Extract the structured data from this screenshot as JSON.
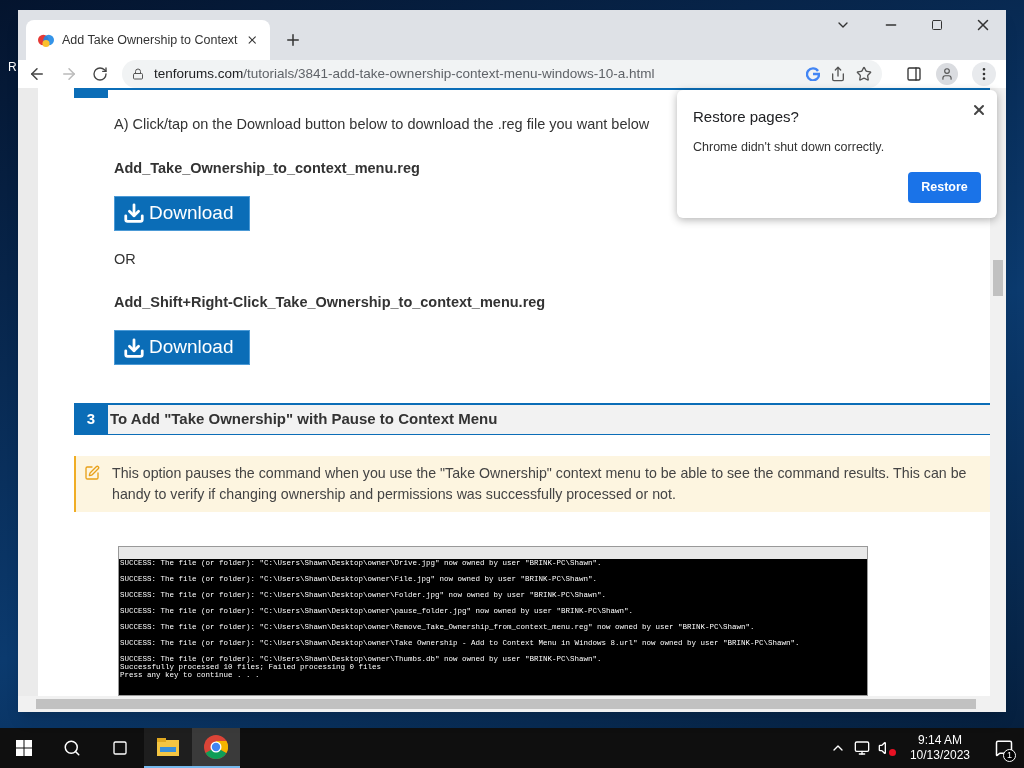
{
  "desktop": {
    "icon_label": "R"
  },
  "browser": {
    "tab": {
      "title": "Add Take Ownership to Context",
      "selected": true
    },
    "address": {
      "domain": "tenforums.com",
      "path": "/tutorials/3841-add-take-ownership-context-menu-windows-10-a.html"
    }
  },
  "article": {
    "step_text": "A) Click/tap on the Download button below to download the .reg file you want below",
    "downloads": [
      {
        "file": "Add_Take_Ownership_to_context_menu.reg",
        "button": "Download"
      },
      {
        "file": "Add_Shift+Right-Click_Take_Ownership_to_context_menu.reg",
        "button": "Download"
      }
    ],
    "separator": "OR",
    "section": {
      "number": "3",
      "title": "To Add \"Take Ownership\" with Pause to Context Menu"
    },
    "note": "This option pauses the command when you use the \"Take Ownership\" context menu to be able to see the command results. This can be handy to verify if changing ownership and permissions was successfully processed or not.",
    "console_lines": [
      "SUCCESS: The file (or folder): \"C:\\Users\\Shawn\\Desktop\\owner\\Drive.jpg\" now owned by user \"BRINK-PC\\Shawn\".",
      "SUCCESS: The file (or folder): \"C:\\Users\\Shawn\\Desktop\\owner\\File.jpg\" now owned by user \"BRINK-PC\\Shawn\".",
      "SUCCESS: The file (or folder): \"C:\\Users\\Shawn\\Desktop\\owner\\Folder.jpg\" now owned by user \"BRINK-PC\\Shawn\".",
      "SUCCESS: The file (or folder): \"C:\\Users\\Shawn\\Desktop\\owner\\pause_folder.jpg\" now owned by user \"BRINK-PC\\Shawn\".",
      "SUCCESS: The file (or folder): \"C:\\Users\\Shawn\\Desktop\\owner\\Remove_Take_Ownership_from_context_menu.reg\" now owned by user \"BRINK-PC\\Shawn\".",
      "SUCCESS: The file (or folder): \"C:\\Users\\Shawn\\Desktop\\owner\\Take Ownership - Add to Context Menu in Windows 8.url\" now owned by user \"BRINK-PC\\Shawn\".",
      "SUCCESS: The file (or folder): \"C:\\Users\\Shawn\\Desktop\\owner\\Thumbs.db\" now owned by user \"BRINK-PC\\Shawn\"."
    ],
    "console_summary": [
      "Successfully processed 10 files; Failed processing 0 files",
      "Press any key to continue . . ."
    ]
  },
  "popup": {
    "title": "Restore pages?",
    "message": "Chrome didn't shut down correctly.",
    "button": "Restore"
  },
  "taskbar": {
    "apps": [
      {
        "kind": "explorer",
        "selected": false
      },
      {
        "kind": "chrome",
        "selected": true
      }
    ],
    "time": "9:14 AM",
    "date": "10/13/2023",
    "notifications": "1"
  }
}
